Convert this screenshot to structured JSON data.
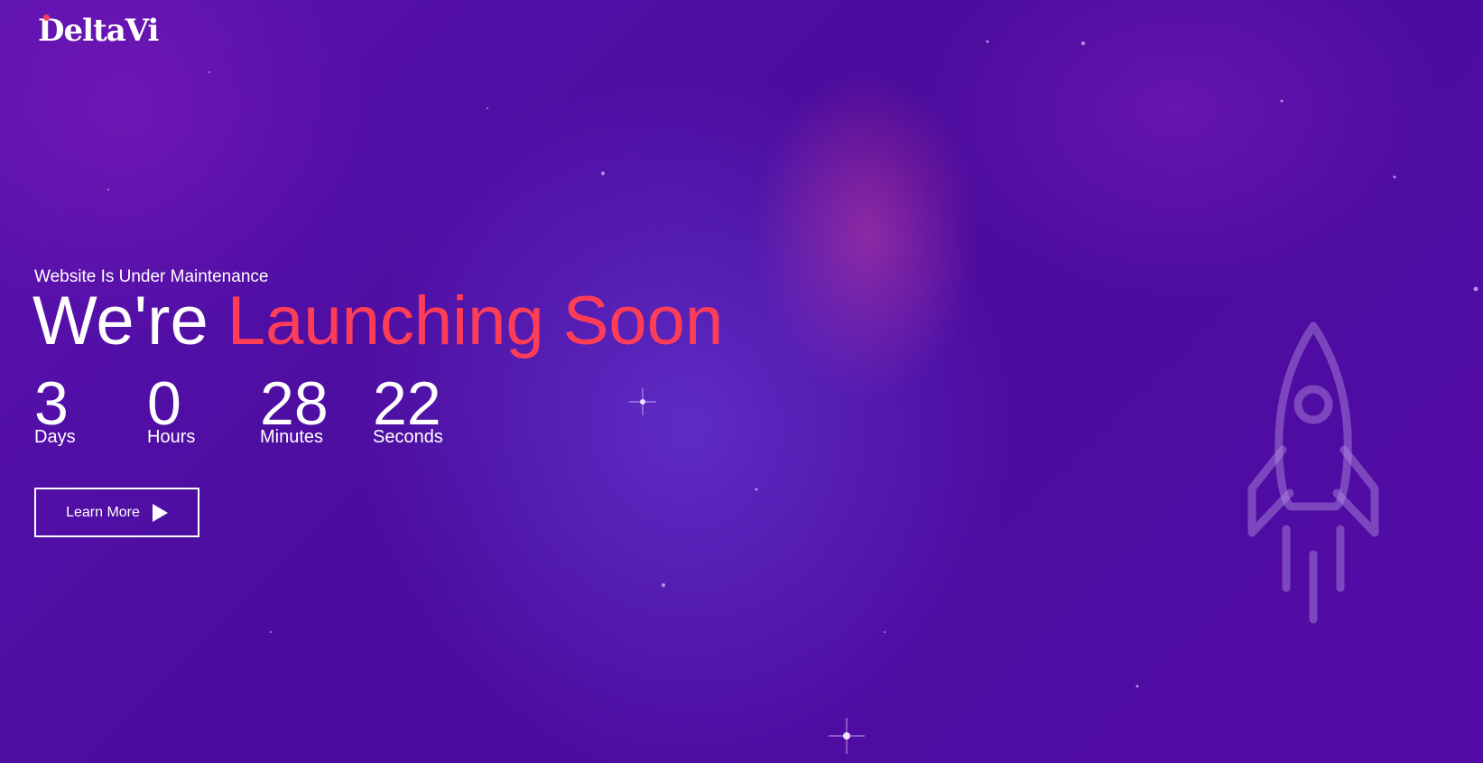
{
  "brand": {
    "name": "DeltaVi"
  },
  "hero": {
    "subtitle": "Website Is Under Maintenance",
    "headline_prefix": "We're",
    "headline_accent": "Launching Soon"
  },
  "countdown": [
    {
      "value": "3",
      "label": "Days"
    },
    {
      "value": "0",
      "label": "Hours"
    },
    {
      "value": "28",
      "label": "Minutes"
    },
    {
      "value": "22",
      "label": "Seconds"
    }
  ],
  "cta": {
    "label": "Learn More",
    "icon": "play-icon"
  },
  "decor": {
    "icon": "rocket-icon"
  },
  "colors": {
    "background": "#4f0aa0",
    "accent": "#ff3d57",
    "text": "#ffffff"
  }
}
